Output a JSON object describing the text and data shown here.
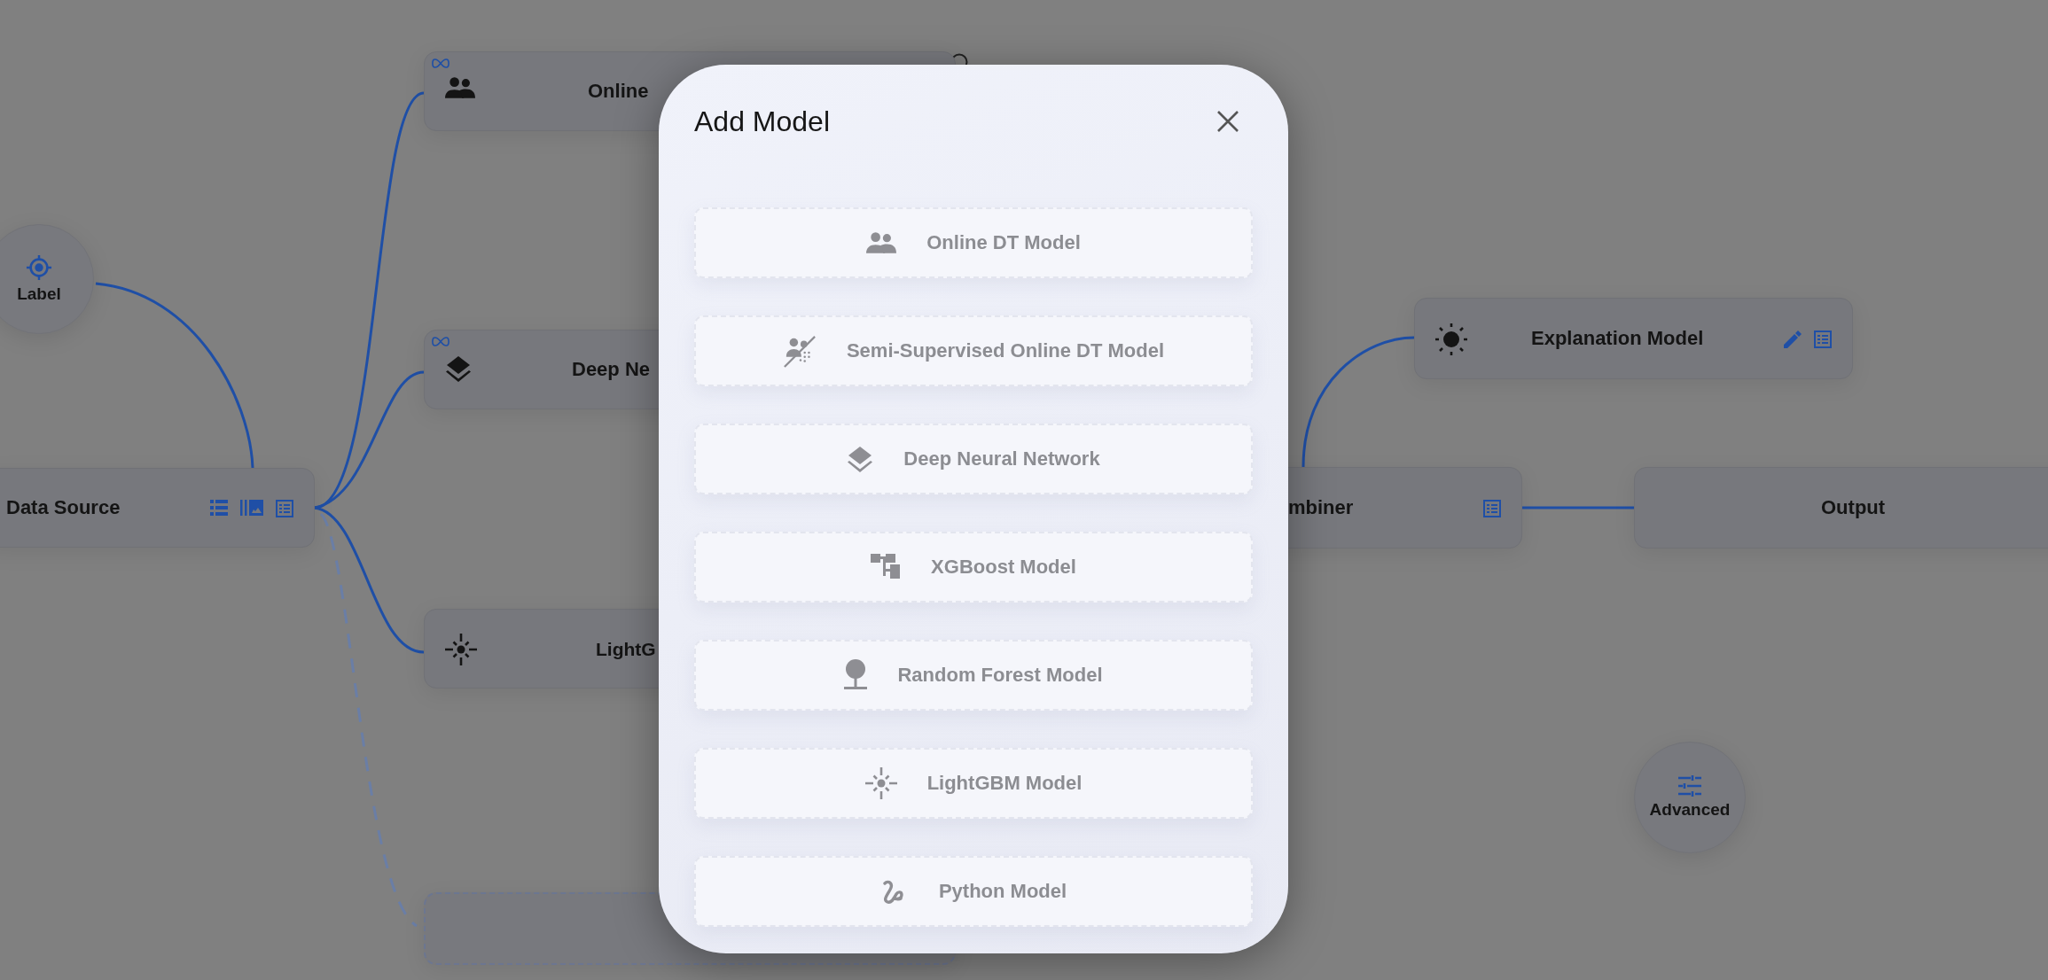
{
  "canvas": {
    "nodes": [
      {
        "kind": "circle",
        "label": "Label"
      },
      {
        "kind": "model",
        "label": "Online",
        "infinite": true
      },
      {
        "kind": "model",
        "label": "Deep Ne",
        "infinite": true
      },
      {
        "kind": "box",
        "label": "Data Source"
      },
      {
        "kind": "model",
        "label": "LightG",
        "infinite": false
      },
      {
        "kind": "placeholder"
      },
      {
        "kind": "model",
        "label": "Explanation Model",
        "infinite": false
      },
      {
        "kind": "box",
        "label": "mbiner"
      },
      {
        "kind": "box",
        "label": "Output"
      },
      {
        "kind": "circle",
        "label": "Advanced"
      }
    ]
  },
  "modal": {
    "title": "Add Model",
    "options": [
      "Online DT Model",
      "Semi-Supervised Online DT Model",
      "Deep Neural Network",
      "XGBoost Model",
      "Random Forest Model",
      "LightGBM Model",
      "Python Model"
    ]
  }
}
